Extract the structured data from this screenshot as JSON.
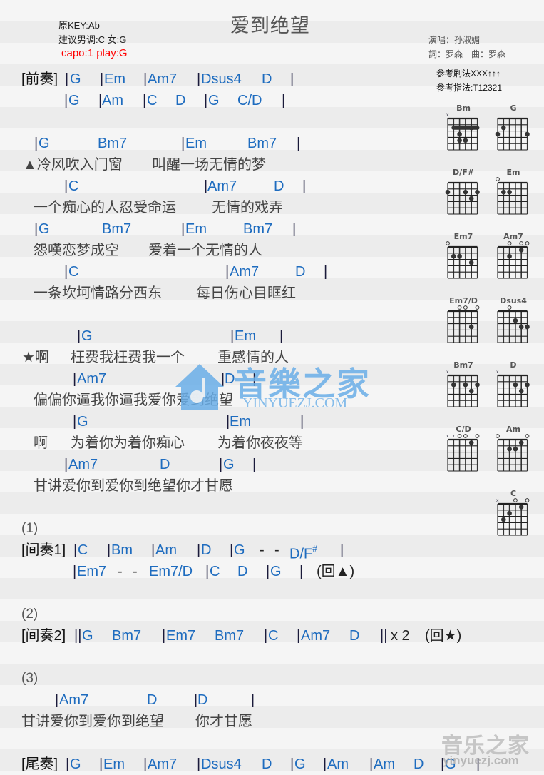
{
  "header": {
    "title": "爱到绝望",
    "original_key": "原KEY:Ab",
    "suggested_key": "建议男调:C 女:G",
    "capo": "capo:1 play:G",
    "singer": "演唱：孙淑媚",
    "credits": "詞：罗森　曲：罗森",
    "strum": "参考刷法XXX↑↑↑",
    "pick": "参考指法:T12321"
  },
  "sheet": {
    "prelude": {
      "label": "[前奏]",
      "line1": [
        "G",
        "Em",
        "Am7",
        "Dsus4",
        "D"
      ],
      "line2": [
        "G",
        "Am",
        "C",
        "D",
        "G",
        "C/D"
      ]
    },
    "verse": [
      {
        "chords": [
          "G",
          "Bm7",
          "Em",
          "Bm7"
        ],
        "lyric_a": "▲冷风吹入门窗",
        "lyric_b": "叫醒一场无情的梦"
      },
      {
        "chords": [
          "C",
          "Am7",
          "D"
        ],
        "lyric_a": "一个痴心的人忍受命运",
        "lyric_b": "无情的戏弄"
      },
      {
        "chords": [
          "G",
          "Bm7",
          "Em",
          "Bm7"
        ],
        "lyric_a": "怨嘆恋梦成空",
        "lyric_b": "爱着一个无情的人"
      },
      {
        "chords": [
          "C",
          "Am7",
          "D"
        ],
        "lyric_a": "一条坎坷情路分西东",
        "lyric_b": "每日伤心目眶红"
      }
    ],
    "chorus": [
      {
        "chords": [
          "G",
          "Em"
        ],
        "lyric_a": "★啊",
        "lyric_b": "枉费我枉费我一个",
        "lyric_c": "重感情的人"
      },
      {
        "chords": [
          "Am7",
          "D"
        ],
        "lyric_a": "偏偏你逼我你逼我爱你爱到绝望"
      },
      {
        "chords": [
          "G",
          "Em"
        ],
        "lyric_a": "啊",
        "lyric_b": "为着你为着你痴心",
        "lyric_c": "为着你夜夜等"
      },
      {
        "chords": [
          "Am7",
          "D",
          "G"
        ],
        "lyric_a": "甘讲爱你到爱你到绝望你才甘愿"
      }
    ],
    "section1": {
      "marker": "(1)",
      "label": "[间奏1]",
      "line1": [
        "C",
        "Bm",
        "Am",
        "D",
        "G",
        "-",
        "-",
        "D/F",
        "#"
      ],
      "line2": [
        "Em7",
        "-",
        "-",
        "Em7/D",
        "C",
        "D",
        "G"
      ],
      "return": "(回▲)"
    },
    "section2": {
      "marker": "(2)",
      "label": "[间奏2]",
      "chords": [
        "G",
        "Bm7",
        "Em7",
        "Bm7",
        "C",
        "Am7",
        "D"
      ],
      "repeat": "x 2",
      "return": "(回★)"
    },
    "section3": {
      "marker": "(3)",
      "chords": [
        "Am7",
        "D",
        "D"
      ],
      "lyric_a": "甘讲爱你到爱你到绝望",
      "lyric_b": "你才甘愿"
    },
    "outro": {
      "label": "[尾奏]",
      "chords": [
        "G",
        "Em",
        "Am7",
        "Dsus4",
        "D",
        "G",
        "Am",
        "Am",
        "D",
        "G"
      ]
    }
  },
  "chord_diagrams": [
    {
      "name": "Bm",
      "markers": "x.....",
      "barre": {
        "fret": 2,
        "from": 1,
        "to": 5
      },
      "dots": [
        [
          2,
          2
        ],
        [
          4,
          3
        ],
        [
          4,
          4
        ],
        [
          3,
          4
        ]
      ]
    },
    {
      "name": "G",
      "markers": "......",
      "dots": [
        [
          6,
          3
        ],
        [
          5,
          2
        ],
        [
          1,
          3
        ]
      ]
    },
    {
      "name": "D/F#",
      "markers": "......",
      "dots": [
        [
          6,
          2
        ],
        [
          3,
          2
        ],
        [
          1,
          2
        ],
        [
          2,
          3
        ]
      ]
    },
    {
      "name": "Em",
      "markers": "o.....",
      "dots": [
        [
          5,
          2
        ],
        [
          4,
          2
        ]
      ]
    },
    {
      "name": "Em7",
      "markers": "o.....",
      "dots": [
        [
          5,
          2
        ],
        [
          4,
          2
        ],
        [
          2,
          3
        ]
      ]
    },
    {
      "name": "Am7",
      "markers": "..o.oo",
      "dots": [
        [
          4,
          2
        ],
        [
          2,
          1
        ]
      ]
    },
    {
      "name": "Em7/D",
      "markers": "..oo.o",
      "dots": [
        [
          2,
          3
        ]
      ]
    },
    {
      "name": "Dsus4",
      "markers": "..o...",
      "dots": [
        [
          3,
          2
        ],
        [
          2,
          3
        ],
        [
          1,
          3
        ]
      ]
    },
    {
      "name": "Bm7",
      "markers": "x.....",
      "dots": [
        [
          5,
          2
        ],
        [
          3,
          2
        ],
        [
          1,
          2
        ],
        [
          2,
          3
        ]
      ]
    },
    {
      "name": "D",
      "markers": "x.....",
      "dots": [
        [
          3,
          2
        ],
        [
          1,
          2
        ],
        [
          2,
          3
        ]
      ]
    },
    {
      "name": "C/D",
      "markers": "xxoo.o",
      "dots": [
        [
          2,
          1
        ]
      ]
    },
    {
      "name": "Am",
      "markers": "o....o",
      "dots": [
        [
          4,
          2
        ],
        [
          3,
          2
        ],
        [
          2,
          1
        ]
      ]
    },
    {
      "name": "C",
      "markers": "x..o.o",
      "dots": [
        [
          5,
          3
        ],
        [
          4,
          2
        ],
        [
          2,
          1
        ]
      ]
    }
  ],
  "watermarks": {
    "center_text": "音樂之家",
    "center_url": "YINYUEZJ.COM",
    "corner_text": "音乐之家",
    "corner_url": "yinyuezj.com"
  },
  "colors": {
    "chord": "#1e6cbf",
    "capo": "#ff0000",
    "lyric": "#444444",
    "watermark": "#6aaee8"
  }
}
